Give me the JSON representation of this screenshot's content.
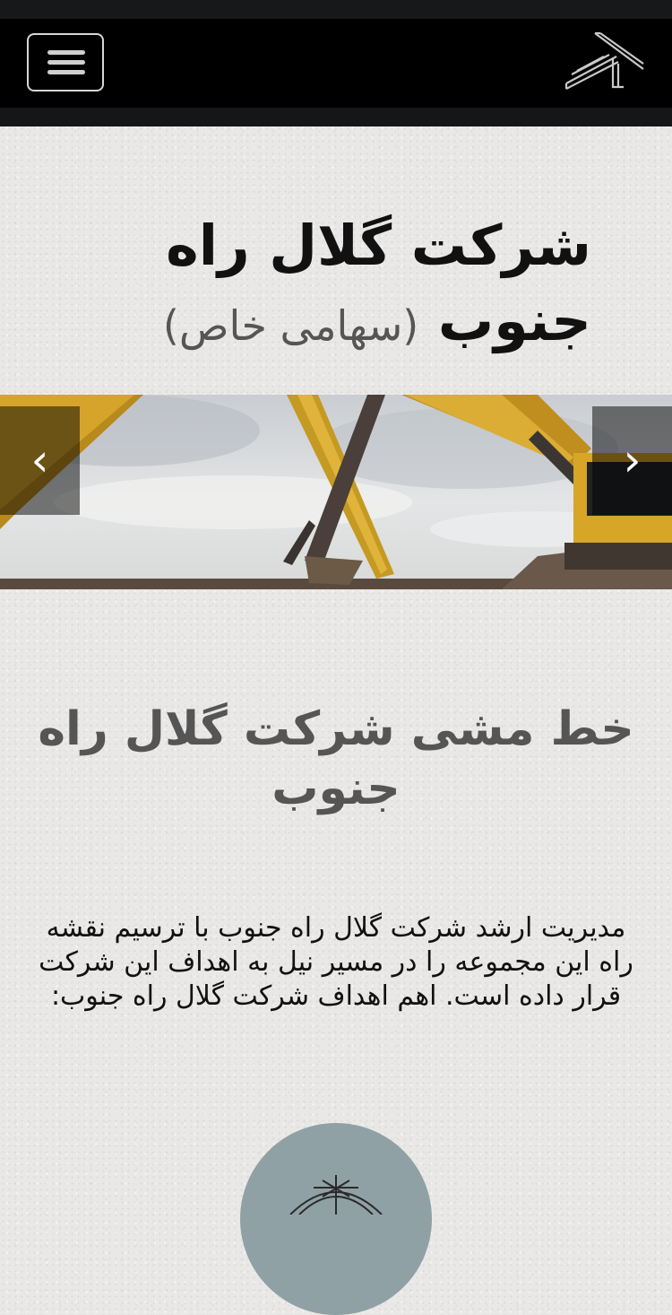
{
  "navbar": {
    "menu_icon": "hamburger-menu-icon",
    "logo_icon": "company-logo-icon",
    "colors": {
      "background": "#000000",
      "border": "#151618"
    }
  },
  "hero": {
    "title": "شرکت گلال راه جنوب",
    "subtitle": "(سهامی خاص)"
  },
  "carousel": {
    "prev_icon": "chevron-left-icon",
    "next_icon": "chevron-right-icon",
    "prev_glyph": "‹",
    "next_glyph": "›",
    "slide_icon": "excavator-photo"
  },
  "mission": {
    "title": "خط مشی شرکت گلال راه جنوب",
    "body": "مدیریت ارشد شرکت گلال راه جنوب با ترسیم نقشه راه این مجموعه را در مسیر نیل به اهداف این شرکت قرار داده است. اهم اهداف شرکت گلال راه جنوب:"
  },
  "feature": {
    "icon": "goal-icon",
    "circle_color": "#8fa1a4"
  }
}
